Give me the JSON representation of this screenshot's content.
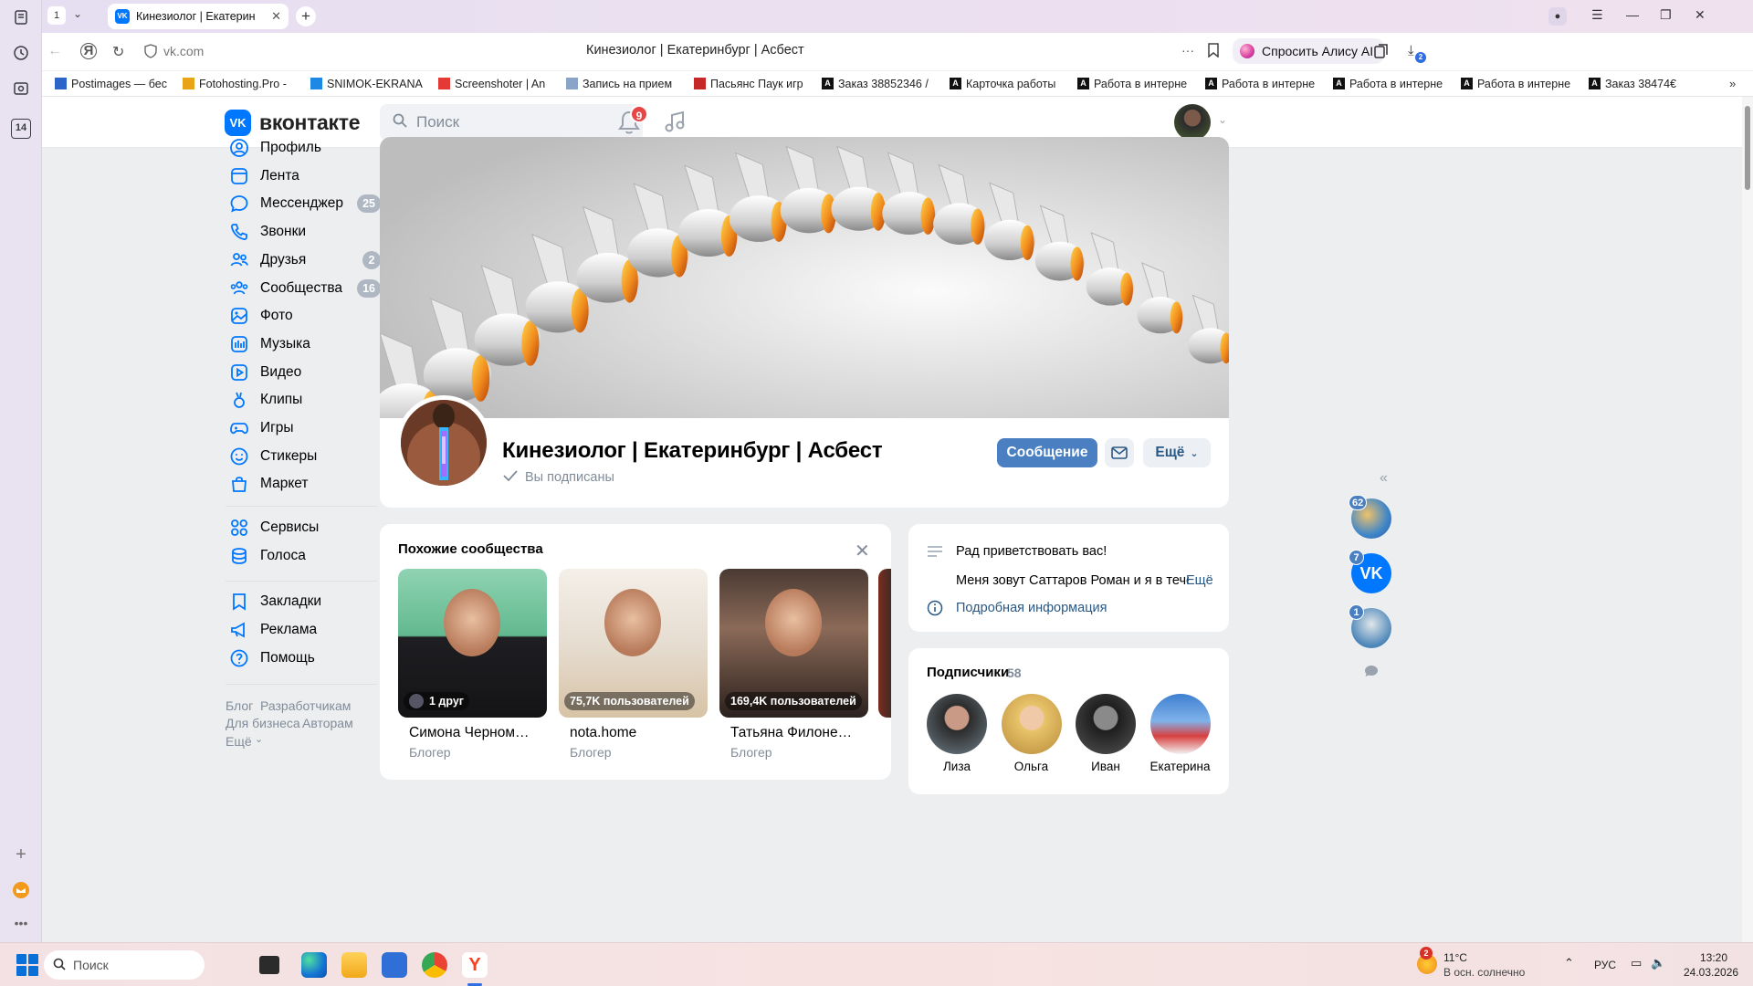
{
  "browser": {
    "tab_counter": "1",
    "active_tab_title": "Кинезиолог | Екатерин",
    "url": "vk.com",
    "page_title": "Кинезиолог | Екатеринбург | Асбест",
    "alice_label": "Спросить Алису AI",
    "downloads_badge": "2",
    "side_badge": "14",
    "bookmarks": [
      {
        "label": "Postimages — бес",
        "icon": "postimages-icon",
        "color": "#2d64c8"
      },
      {
        "label": "Fotohosting.Pro -",
        "icon": "fotohosting-icon",
        "color": "#e8a317"
      },
      {
        "label": "SNIMOK-EKRANA",
        "icon": "snimok-icon",
        "color": "#1e88e5"
      },
      {
        "label": "Screenshoter | An",
        "icon": "screenshoter-icon",
        "color": "#e53935"
      },
      {
        "label": "Запись на прием",
        "icon": "globe-icon",
        "color": "#8aa4c8"
      },
      {
        "label": "Пасьянс Паук игр",
        "icon": "spider-icon",
        "color": "#c62828"
      },
      {
        "label": "Заказ 38852346 /",
        "icon": "a-icon",
        "color": "#111111"
      },
      {
        "label": "Карточка работы",
        "icon": "a-icon",
        "color": "#111111"
      },
      {
        "label": "Работа в интерне",
        "icon": "a-icon",
        "color": "#111111"
      },
      {
        "label": "Работа в интерне",
        "icon": "a-icon",
        "color": "#111111"
      },
      {
        "label": "Работа в интерне",
        "icon": "a-icon",
        "color": "#111111"
      },
      {
        "label": "Работа в интерне",
        "icon": "a-icon",
        "color": "#111111"
      },
      {
        "label": "Заказ 38474€",
        "icon": "a-icon",
        "color": "#111111"
      }
    ]
  },
  "vk": {
    "logo_text": "вконтакте",
    "search_placeholder": "Поиск",
    "notifications_count": "9",
    "nav": [
      {
        "label": "Профиль",
        "icon": "profile-icon",
        "count": ""
      },
      {
        "label": "Лента",
        "icon": "feed-icon",
        "count": ""
      },
      {
        "label": "Мессенджер",
        "icon": "messenger-icon",
        "count": "25"
      },
      {
        "label": "Звонки",
        "icon": "phone-icon",
        "count": ""
      },
      {
        "label": "Друзья",
        "icon": "friends-icon",
        "count": "2"
      },
      {
        "label": "Сообщества",
        "icon": "communities-icon",
        "count": "16"
      },
      {
        "label": "Фото",
        "icon": "photo-icon",
        "count": ""
      },
      {
        "label": "Музыка",
        "icon": "music-icon",
        "count": ""
      },
      {
        "label": "Видео",
        "icon": "video-icon",
        "count": ""
      },
      {
        "label": "Клипы",
        "icon": "clips-icon",
        "count": ""
      },
      {
        "label": "Игры",
        "icon": "games-icon",
        "count": ""
      },
      {
        "label": "Стикеры",
        "icon": "stickers-icon",
        "count": ""
      },
      {
        "label": "Маркет",
        "icon": "market-icon",
        "count": ""
      }
    ],
    "nav2": [
      {
        "label": "Сервисы",
        "icon": "services-icon"
      },
      {
        "label": "Голоса",
        "icon": "coins-icon"
      }
    ],
    "nav3": [
      {
        "label": "Закладки",
        "icon": "bookmark-icon"
      },
      {
        "label": "Реклама",
        "icon": "megaphone-icon"
      },
      {
        "label": "Помощь",
        "icon": "help-icon"
      }
    ],
    "footer_links": [
      "Блог",
      "Разработчикам",
      "Для бизнеса",
      "Авторам",
      "Ещё"
    ]
  },
  "group": {
    "name": "Кинезиолог | Екатеринбург | Асбест",
    "subscribed_label": "Вы подписаны",
    "message_button": "Сообщение",
    "more_button": "Ещё"
  },
  "similar": {
    "title": "Похожие сообщества",
    "items": [
      {
        "name": "Симона Черномор...",
        "sub": "Блогер",
        "tag": "1 друг",
        "has_friend_ava": true
      },
      {
        "name": "nota.home",
        "sub": "Блогер",
        "tag": "75,7K пользователей",
        "has_friend_ava": false
      },
      {
        "name": "Татьяна Филоненко",
        "sub": "Блогер",
        "tag": "169,4K пользователей",
        "has_friend_ava": false
      }
    ]
  },
  "info": {
    "greeting": "Рад приветствовать вас!",
    "intro": "Меня зовут Саттаров Роман и я в течен",
    "intro_more": "Ещё",
    "details_link": "Подробная информация"
  },
  "subscribers": {
    "title": "Подписчики",
    "count": "58",
    "items": [
      {
        "name": "Лиза"
      },
      {
        "name": "Ольга"
      },
      {
        "name": "Иван"
      },
      {
        "name": "Екатерина"
      }
    ]
  },
  "rail": {
    "counts": [
      "62",
      "7",
      "1"
    ]
  },
  "taskbar": {
    "search_label": "Поиск",
    "weather_temp": "11°C",
    "weather_desc": "В осн. солнечно",
    "weather_badge": "2",
    "lang": "РУС",
    "time": "13:20",
    "date": "24.03.2026"
  },
  "colors": {
    "vk_blue": "#0077ff",
    "button_blue": "#4a7fc1",
    "link": "#2a5885",
    "muted": "#818c99",
    "badge_red": "#e64646"
  }
}
